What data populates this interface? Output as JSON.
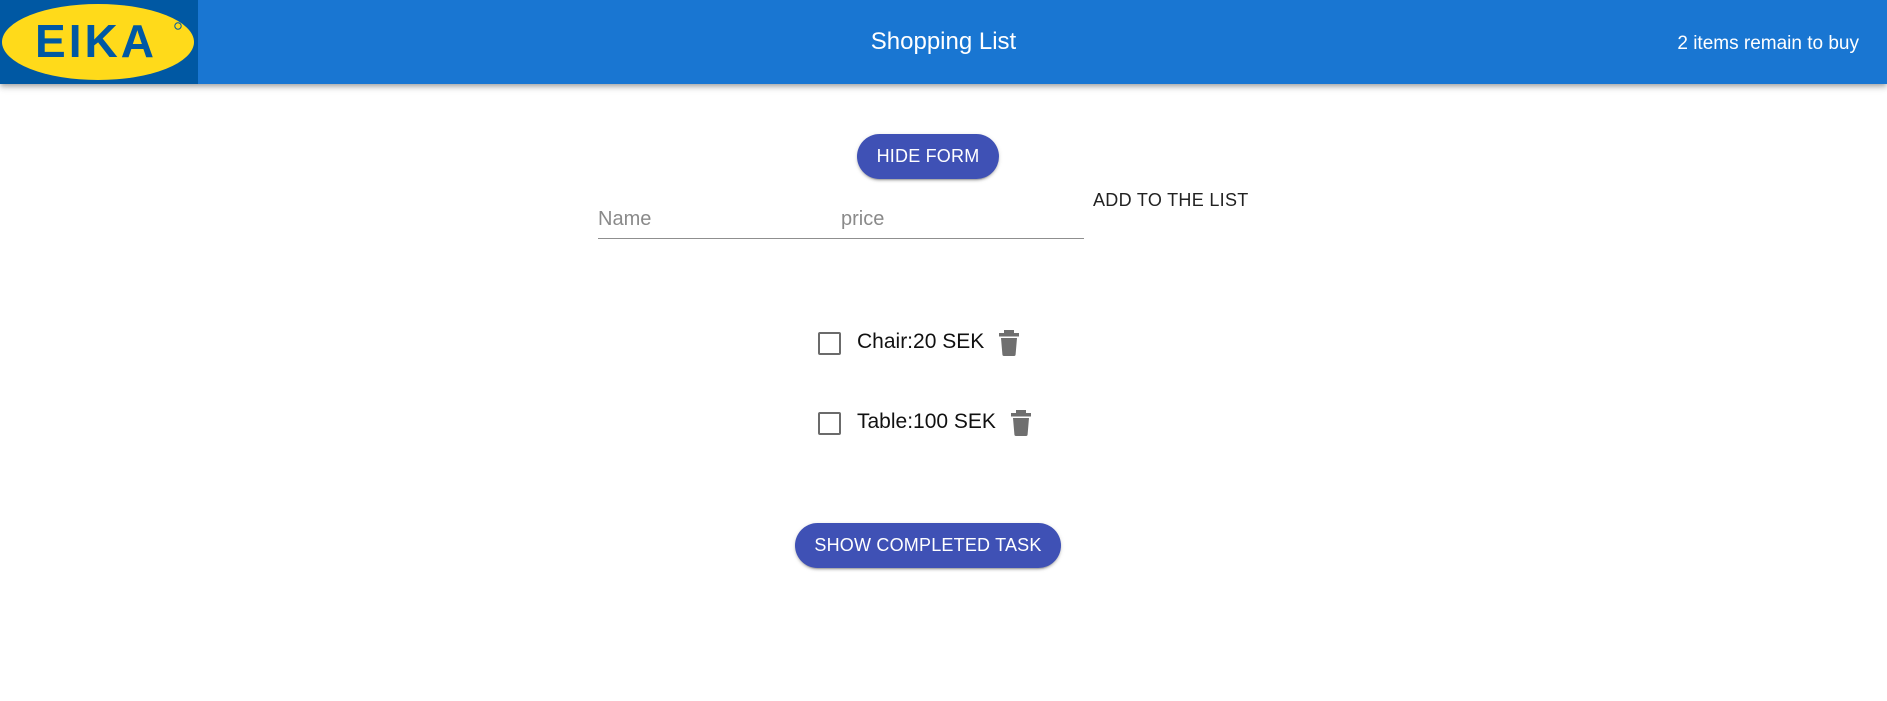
{
  "header": {
    "logo_text": "EIKA",
    "title": "Shopping List",
    "remaining": "2 items remain to buy",
    "bar_color": "#1976d2"
  },
  "form": {
    "toggle_label": "HIDE FORM",
    "name_placeholder": "Name",
    "price_placeholder": "price",
    "add_label": "ADD TO THE LIST"
  },
  "items": [
    {
      "label": "Chair:20 SEK",
      "checked": false,
      "delete_icon": "trash-icon"
    },
    {
      "label": "Table:100 SEK",
      "checked": false,
      "delete_icon": "trash-icon"
    }
  ],
  "footer": {
    "show_completed_label": "SHOW COMPLETED TASK"
  },
  "colors": {
    "primary_button": "#3f51b5",
    "logo_blue": "#0058a3",
    "logo_yellow": "#ffda1a"
  }
}
